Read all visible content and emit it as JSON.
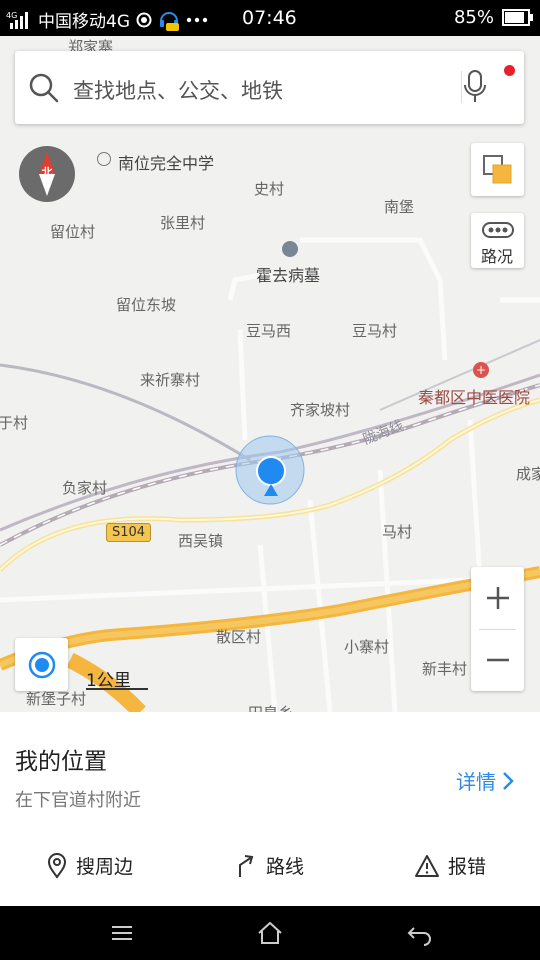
{
  "status_bar": {
    "network_type": "4G",
    "carrier": "中国移动4G",
    "time": "07:46",
    "battery_percent": "85%",
    "battery_level": 0.85
  },
  "search": {
    "placeholder": "查找地点、公交、地铁",
    "icons": [
      "search-icon",
      "microphone-icon"
    ]
  },
  "map": {
    "compass_label": "北",
    "traffic_label": "路况",
    "scale_label": "1公里",
    "road_badge": "S104",
    "railway_label": "陇海线",
    "places": [
      {
        "id": "zhengjia",
        "text": "郑家寨"
      },
      {
        "id": "nanwei-school",
        "text": "南位完全中学"
      },
      {
        "id": "shicun",
        "text": "史村"
      },
      {
        "id": "nanbao",
        "text": "南堡"
      },
      {
        "id": "liuwei",
        "text": "留位村"
      },
      {
        "id": "zhangli",
        "text": "张里村"
      },
      {
        "id": "huoqubing",
        "text": "霍去病墓"
      },
      {
        "id": "liuweidongpo",
        "text": "留位东坡"
      },
      {
        "id": "doumaxi",
        "text": "豆马西"
      },
      {
        "id": "douma",
        "text": "豆马村"
      },
      {
        "id": "laiqizhai",
        "text": "来祈寨村"
      },
      {
        "id": "hospital",
        "text": "秦都区中医医院"
      },
      {
        "id": "qijiapo",
        "text": "齐家坡村"
      },
      {
        "id": "yugan",
        "text": "于村"
      },
      {
        "id": "fujia",
        "text": "负家村"
      },
      {
        "id": "chengjia",
        "text": "成家"
      },
      {
        "id": "xiwu",
        "text": "西吴镇"
      },
      {
        "id": "macun",
        "text": "马村"
      },
      {
        "id": "sanqu",
        "text": "散区村"
      },
      {
        "id": "xiaozhai",
        "text": "小寨村"
      },
      {
        "id": "xinfeng",
        "text": "新丰村"
      },
      {
        "id": "xinbaozi",
        "text": "新堡子村"
      },
      {
        "id": "tianhuang",
        "text": "田皇乡"
      }
    ]
  },
  "location_sheet": {
    "title": "我的位置",
    "subtitle": "在下官道村附近",
    "detail_label": "详情",
    "actions": [
      {
        "label": "搜周边",
        "icon": "location-pin-icon"
      },
      {
        "label": "路线",
        "icon": "route-arrow-icon"
      },
      {
        "label": "报错",
        "icon": "warning-icon"
      }
    ]
  },
  "colors": {
    "accent_blue": "#2e8ae6",
    "highway": "#f4b63e",
    "notification_red": "#e8202a"
  }
}
